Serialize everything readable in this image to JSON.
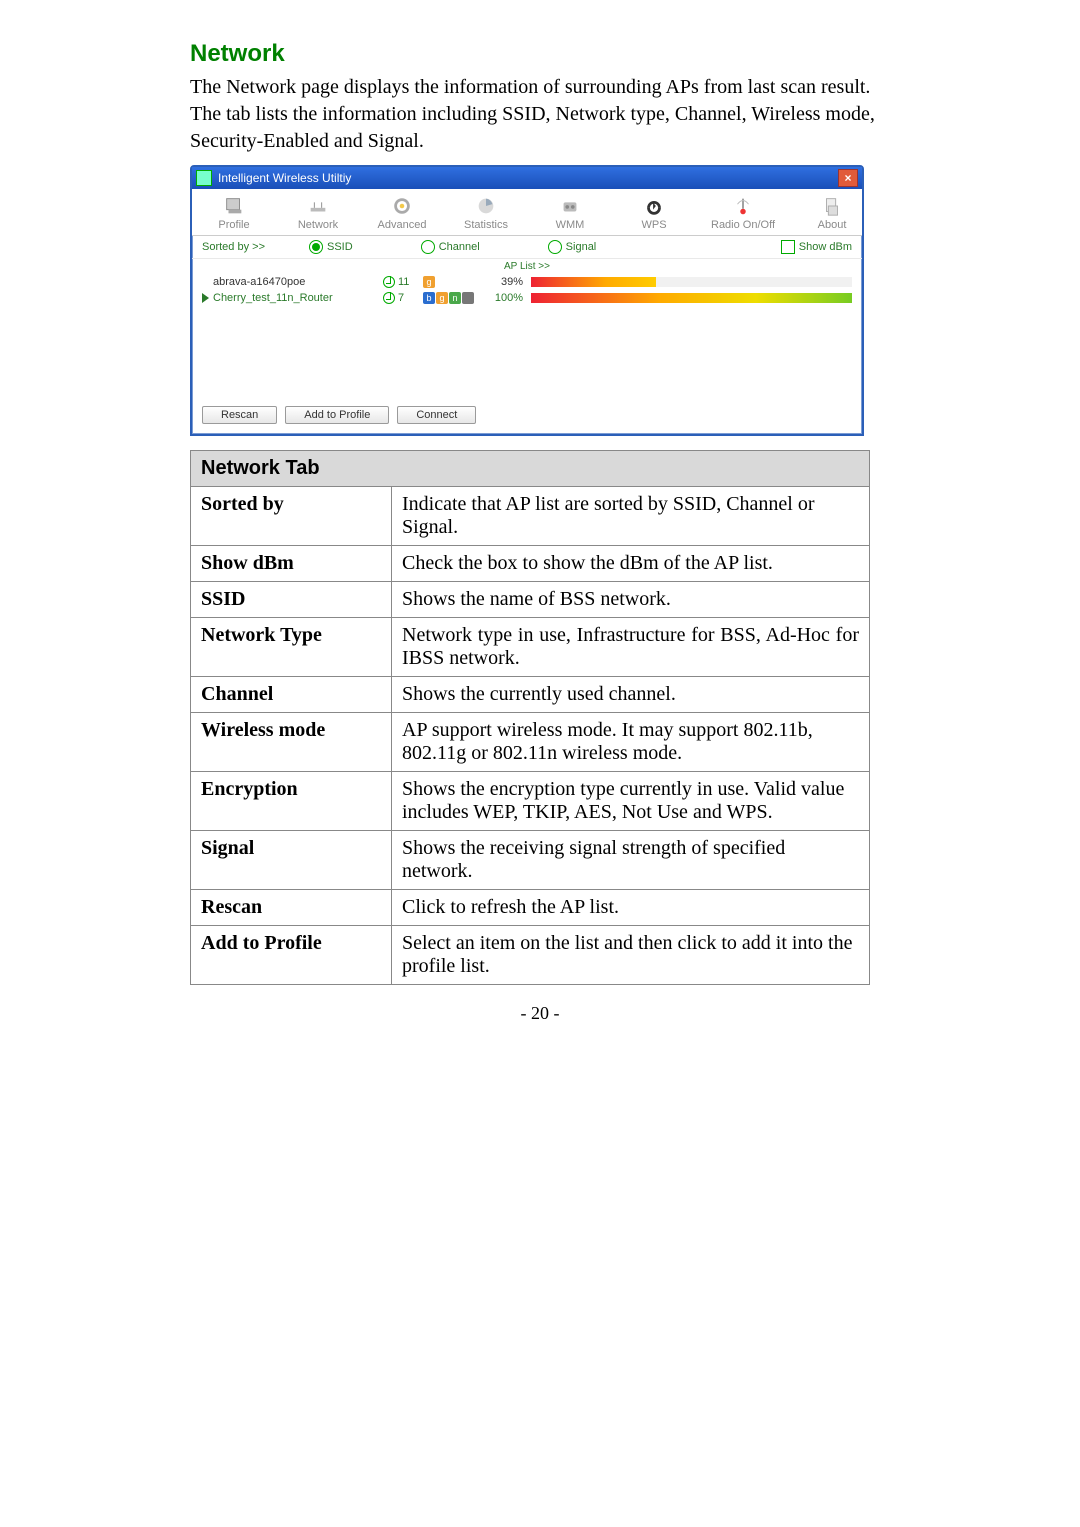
{
  "section_title": "Network",
  "intro_text": "The Network page displays the information of surrounding APs from last scan result. The tab lists the information including SSID, Network type, Channel, Wireless mode, Security-Enabled and Signal.",
  "app": {
    "window_title": "Intelligent Wireless Utiltiy",
    "close_glyph": "×",
    "tools": {
      "profile": "Profile",
      "network": "Network",
      "advanced": "Advanced",
      "statistics": "Statistics",
      "wmm": "WMM",
      "wps": "WPS",
      "radio": "Radio On/Off",
      "about": "About"
    },
    "sort": {
      "sorted_by": "Sorted by >>",
      "ssid": "SSID",
      "channel": "Channel",
      "signal": "Signal",
      "show_dbm": "Show dBm"
    },
    "aplist_label": "AP List >>",
    "rows": [
      {
        "ssid": "abrava-a16470poe",
        "ch": "11",
        "pct": "39%",
        "fill": 39
      },
      {
        "ssid": "Cherry_test_11n_Router",
        "ch": "7",
        "pct": "100%",
        "fill": 100
      }
    ],
    "buttons": {
      "rescan": "Rescan",
      "add_to_profile": "Add to Profile",
      "connect": "Connect"
    }
  },
  "table": {
    "header": "Network Tab",
    "rows": {
      "sorted_by": {
        "k": "Sorted by",
        "v": "Indicate that AP list are sorted by SSID, Channel or Signal."
      },
      "show_dbm": {
        "k": "Show dBm",
        "v": "Check the box to show the dBm of the AP list."
      },
      "ssid": {
        "k": "SSID",
        "v": "Shows the name of BSS network."
      },
      "network_type": {
        "k": "Network Type",
        "v": "Network type in use, Infrastructure for BSS, Ad-Hoc for IBSS network."
      },
      "channel": {
        "k": "Channel",
        "v": "Shows the currently used channel."
      },
      "wireless_mode": {
        "k": "Wireless mode",
        "v": "AP support wireless mode. It may support 802.11b, 802.11g or 802.11n wireless mode."
      },
      "encryption": {
        "k": "Encryption",
        "v": "Shows the encryption type currently in use. Valid value includes WEP, TKIP, AES, Not Use and WPS."
      },
      "signal": {
        "k": "Signal",
        "v": "Shows the receiving signal strength of specified network."
      },
      "rescan": {
        "k": "Rescan",
        "v": "Click to refresh the AP list."
      },
      "add_to_profile": {
        "k": "Add to Profile",
        "v": "Select an item on the list and then click to add it into the profile list."
      }
    }
  },
  "page_number": "- 20 -"
}
